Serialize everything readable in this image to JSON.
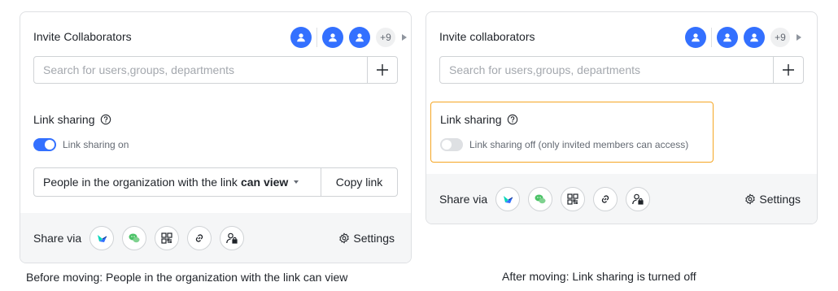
{
  "left_panel": {
    "invite_title": "Invite Collaborators",
    "more_count": "+9",
    "search_placeholder": "Search for users,groups, departments",
    "link_sharing_title": "Link sharing",
    "toggle_state": "on",
    "toggle_label": "Link sharing on",
    "permission_prefix": "People in the organization with the link",
    "permission_bold": "can view",
    "copy_link_label": "Copy link",
    "share_via_label": "Share via",
    "settings_label": "Settings"
  },
  "right_panel": {
    "invite_title": "Invite collaborators",
    "more_count": "+9",
    "search_placeholder": "Search for users,groups, departments",
    "link_sharing_title": "Link sharing",
    "toggle_state": "off",
    "toggle_label": "Link sharing off (only invited members can access)",
    "share_via_label": "Share via",
    "settings_label": "Settings"
  },
  "captions": {
    "left": "Before moving: People in the organization with the link can view",
    "right": "After moving: Link sharing is turned off"
  },
  "colors": {
    "accent": "#3370ff",
    "highlight": "#f5a623",
    "share_bar_bg": "#f5f6f7"
  },
  "share_icons": [
    "lark-icon",
    "wechat-icon",
    "qr-code-icon",
    "link-icon",
    "user-lock-icon"
  ]
}
